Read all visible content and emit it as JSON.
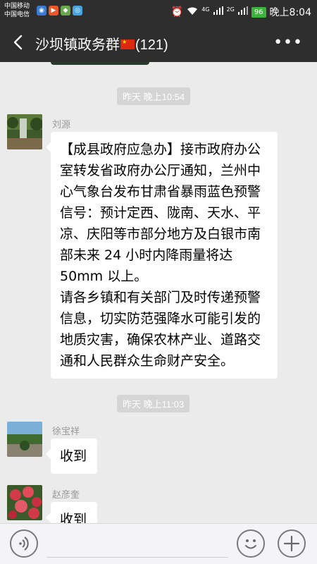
{
  "status_bar": {
    "carrier_1": "中国移动",
    "carrier_2": "中国电信",
    "battery": "96",
    "time": "晚上8:04",
    "network_1": "4G",
    "network_2": "2G"
  },
  "header": {
    "title": "沙坝镇政务群",
    "member_count": "(121)"
  },
  "chat": {
    "timestamps": [
      "昨天 晚上10:54",
      "昨天 晚上11:03"
    ],
    "messages": [
      {
        "sender": "刘源",
        "paragraph_1": "【成县政府应急办】接市政府办公室转发省政府办公厅通知，兰州中心气象台发布甘肃省暴雨蓝色预警信号：预计定西、陇南、天水、平凉、庆阳等市部分地方及白银市南部未来 24 小时内降雨量将达 50mm 以上。",
        "paragraph_2": "请各乡镇和有关部门及时传递预警信息，切实防范强降水可能引发的地质灾害，确保农林产业、道路交通和人民群众生命财产安全。"
      },
      {
        "sender": "徐宝祥",
        "text": "收到"
      },
      {
        "sender": "赵彦奎",
        "text": "收到"
      }
    ]
  },
  "input_bar": {
    "voice_icon": "voice-icon",
    "emoji_icon": "emoji-icon",
    "plus_icon": "plus-icon"
  },
  "colors": {
    "header_bg": "#2e2e2e",
    "chat_bg": "#ebebeb",
    "battery": "#3db33d"
  }
}
